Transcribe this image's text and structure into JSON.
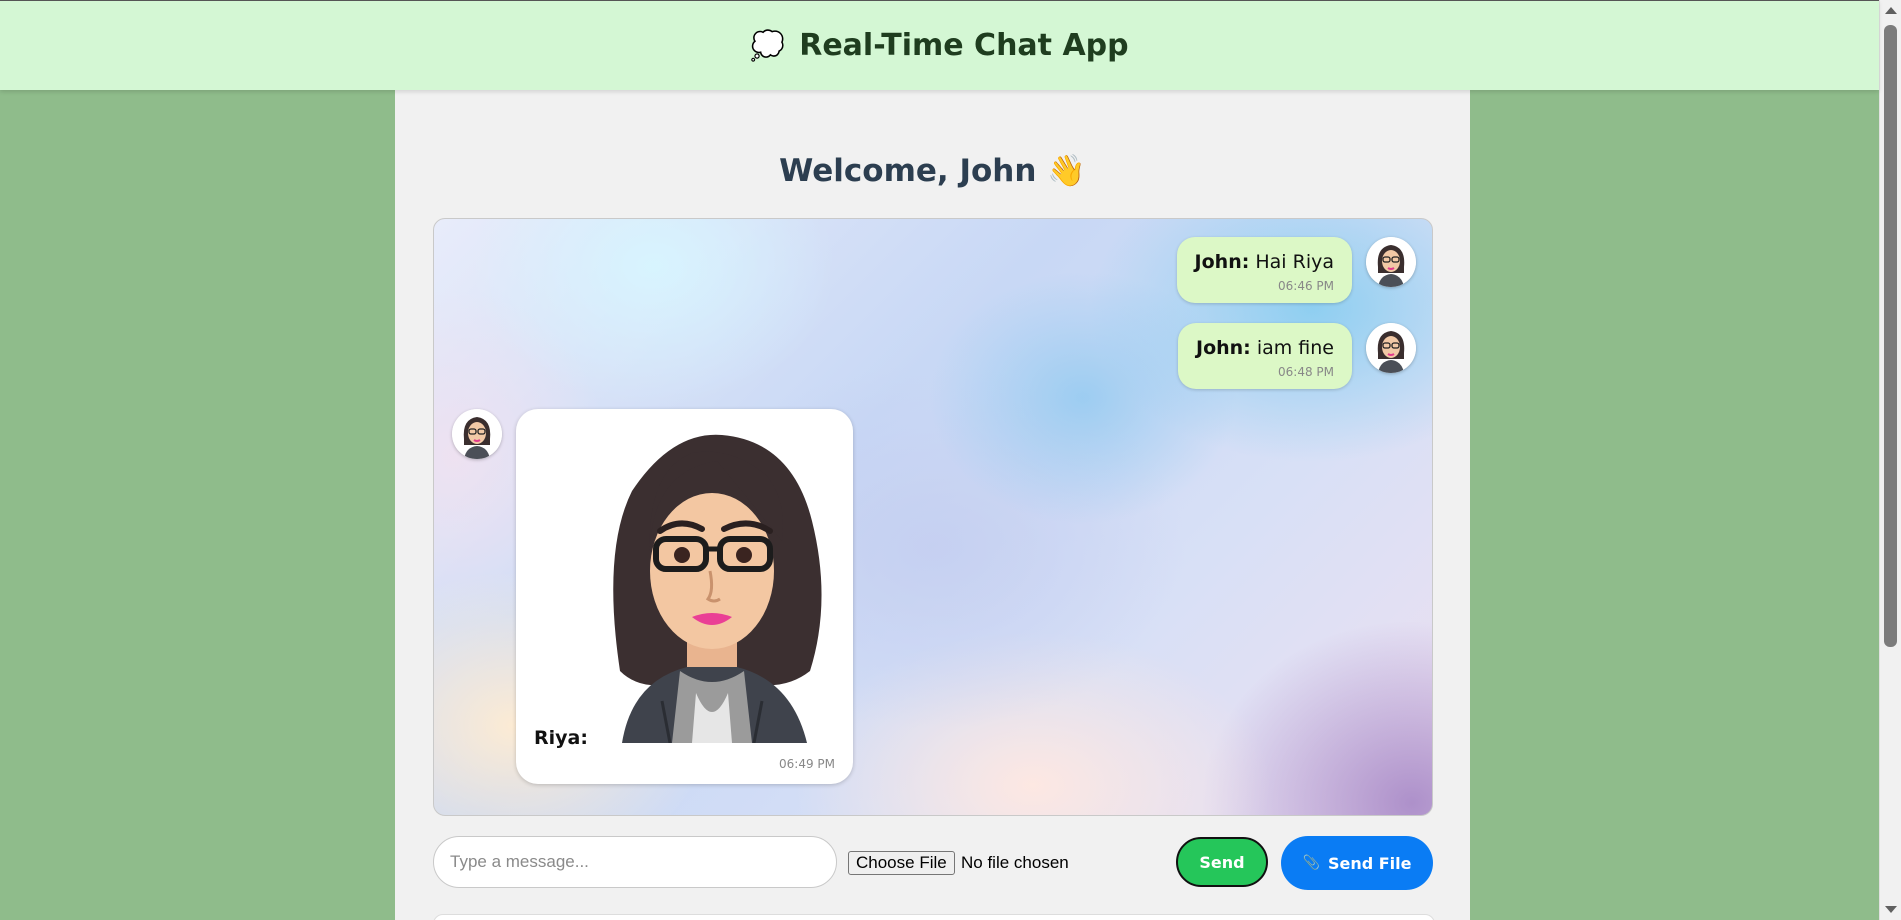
{
  "header": {
    "icon": "speech-bubble-icon",
    "icon_glyph": "💭",
    "title": "Real-Time Chat App"
  },
  "welcome": "Welcome, John 👋",
  "messages": [
    {
      "sender": "John:",
      "text": "Hai Riya",
      "time": "06:46 PM",
      "direction": "outgoing"
    },
    {
      "sender": "John:",
      "text": "iam fine",
      "time": "06:48 PM",
      "direction": "outgoing"
    },
    {
      "sender": "Riya:",
      "text": "",
      "attachment": "avatar-image",
      "time": "06:49 PM",
      "direction": "incoming"
    }
  ],
  "composer": {
    "placeholder": "Type a message...",
    "choose_file_label": "Choose File",
    "file_status": "No file chosen",
    "send_label": "Send",
    "send_file_label": "Send File",
    "send_file_icon": "paperclip-icon"
  },
  "colors": {
    "header_bg": "#d4f7d4",
    "page_bg": "#8fbc8b",
    "outgoing_bubble": "#dcf8c6",
    "send_button": "#25c65a",
    "send_file_button": "#0a7cf4"
  }
}
